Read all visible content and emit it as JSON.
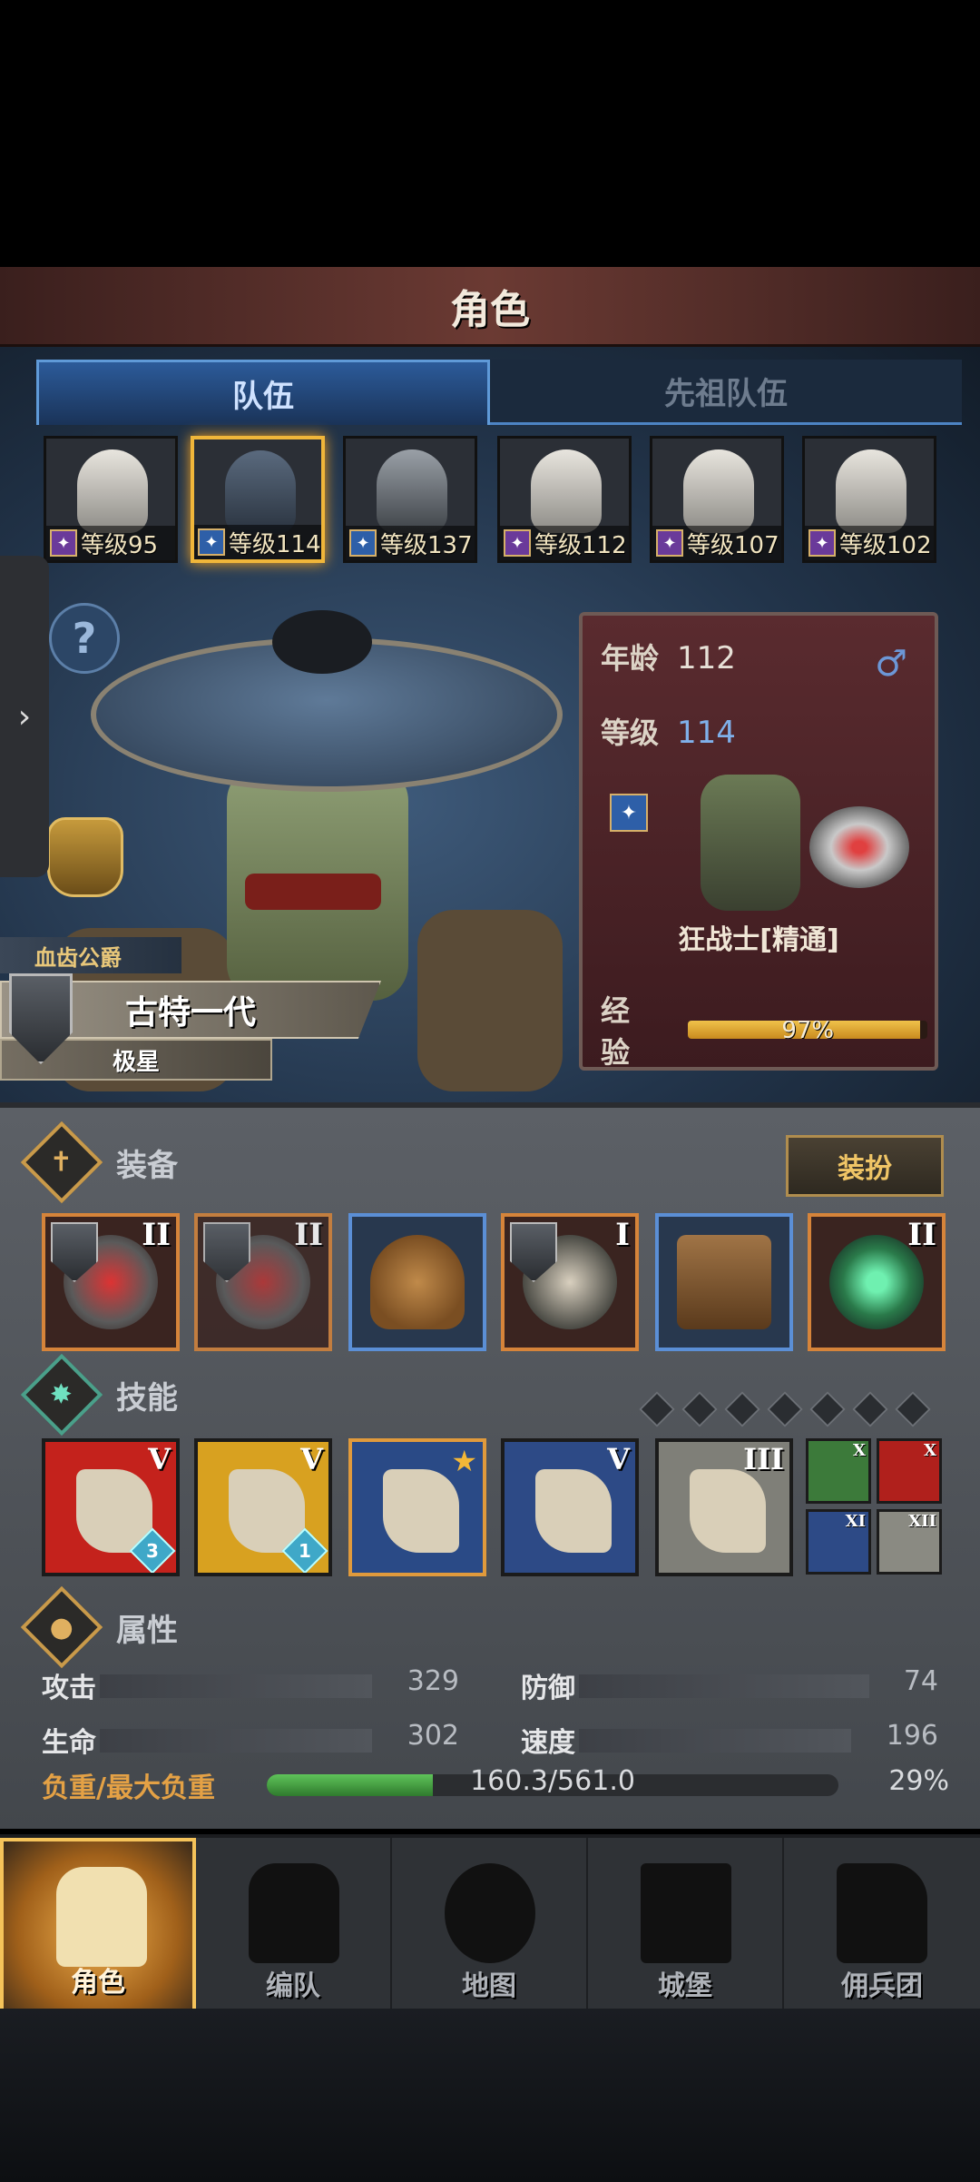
{
  "header": {
    "title": "角色"
  },
  "tabs": [
    {
      "label": "队伍",
      "active": true
    },
    {
      "label": "先祖队伍",
      "active": false
    }
  ],
  "roster": [
    {
      "level_label": "等级95",
      "class_color": "#6a3a9a",
      "selected": false
    },
    {
      "level_label": "等级114",
      "class_color": "#2e5fa8",
      "selected": true
    },
    {
      "level_label": "等级137",
      "class_color": "#2e5fa8",
      "selected": false
    },
    {
      "level_label": "等级112",
      "class_color": "#6a3a9a",
      "selected": false
    },
    {
      "level_label": "等级107",
      "class_color": "#6a3a9a",
      "selected": false
    },
    {
      "level_label": "等级102",
      "class_color": "#6a3a9a",
      "selected": false
    }
  ],
  "character": {
    "title": "血齿公爵",
    "name": "古特一代",
    "rank": "极星",
    "age_label": "年龄",
    "age": "112",
    "gender_icon": "♂",
    "level_label": "等级",
    "level": "114",
    "class_name": "狂战士[精通]",
    "exp_label": "经验",
    "exp_percent_text": "97%",
    "exp_fraction": 0.97
  },
  "equipment": {
    "title": "装备",
    "dress_button": "装扮",
    "slots": [
      {
        "name": "axe",
        "tier": "II",
        "rarity": "orange"
      },
      {
        "name": "axe-2",
        "tier": "II",
        "rarity": "orange"
      },
      {
        "name": "helmet",
        "tier": "",
        "rarity": "blue"
      },
      {
        "name": "armor",
        "tier": "I",
        "rarity": "orange"
      },
      {
        "name": "boots",
        "tier": "",
        "rarity": "blue"
      },
      {
        "name": "ring",
        "tier": "II",
        "rarity": "orange"
      }
    ]
  },
  "skills": {
    "title": "技能",
    "slots": [
      {
        "tier": "V",
        "gem": "3",
        "bg": "#c4221c"
      },
      {
        "tier": "V",
        "gem": "1",
        "bg": "#d8a120"
      },
      {
        "tier": "★",
        "gem": "",
        "bg": "#2a4a86"
      },
      {
        "tier": "V",
        "gem": "",
        "bg": "#2d4a86"
      },
      {
        "tier": "III",
        "gem": "",
        "bg": "#7f7f78"
      }
    ],
    "passives": [
      {
        "tier": "X",
        "bg": "#3c7a3a"
      },
      {
        "tier": "X",
        "bg": "#b0201c"
      },
      {
        "tier": "XI",
        "bg": "#2d4a86"
      },
      {
        "tier": "XII",
        "bg": "#8a8a82"
      }
    ]
  },
  "attributes": {
    "title": "属性",
    "stats": [
      {
        "label": "攻击",
        "value": "329"
      },
      {
        "label": "防御",
        "value": "74"
      },
      {
        "label": "生命",
        "value": "302"
      },
      {
        "label": "速度",
        "value": "196"
      }
    ],
    "load_label": "负重/最大负重",
    "load_text": "160.3/561.0",
    "load_percent": "29%",
    "load_fraction": 0.29
  },
  "nav": [
    {
      "label": "角色",
      "active": true
    },
    {
      "label": "编队",
      "active": false
    },
    {
      "label": "地图",
      "active": false
    },
    {
      "label": "城堡",
      "active": false
    },
    {
      "label": "佣兵团",
      "active": false
    }
  ],
  "side_tab_icon": "›",
  "help_icon": "?"
}
